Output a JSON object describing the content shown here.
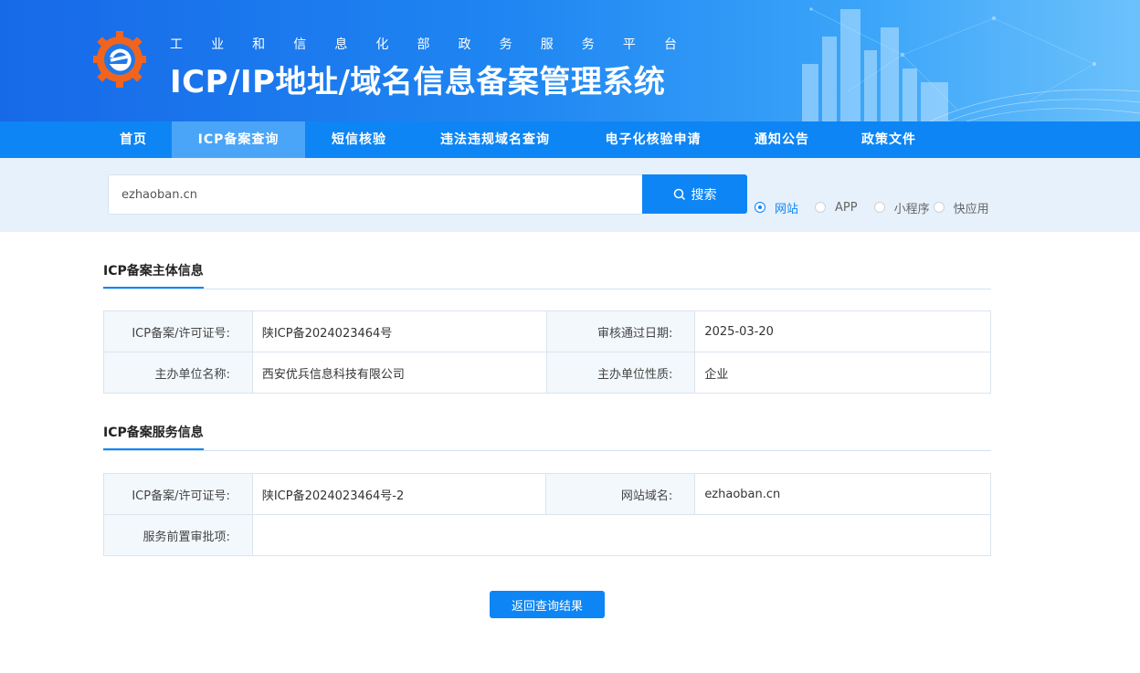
{
  "header": {
    "ministry_chars": [
      "工",
      "业",
      "和",
      "信",
      "息",
      "化",
      "部",
      "政",
      "务",
      "服",
      "务",
      "平",
      "台"
    ],
    "system_title": "ICP/IP地址/域名信息备案管理系统"
  },
  "nav": {
    "items": [
      {
        "label": "首页",
        "active": false
      },
      {
        "label": "ICP备案查询",
        "active": true
      },
      {
        "label": "短信核验",
        "active": false
      },
      {
        "label": "违法违规域名查询",
        "active": false
      },
      {
        "label": "电子化核验申请",
        "active": false
      },
      {
        "label": "通知公告",
        "active": false
      },
      {
        "label": "政策文件",
        "active": false
      }
    ]
  },
  "search": {
    "value": "ezhaoban.cn",
    "button_label": "搜索",
    "button_icon": "search-icon",
    "types": [
      {
        "label": "网站",
        "checked": true
      },
      {
        "label": "APP",
        "checked": false
      },
      {
        "label": "小程序",
        "checked": false
      },
      {
        "label": "快应用",
        "checked": false
      }
    ]
  },
  "subject_info": {
    "title": "ICP备案主体信息",
    "rows": [
      {
        "k1": "ICP备案/许可证号:",
        "v1": "陕ICP备2024023464号",
        "k2": "审核通过日期:",
        "v2": "2025-03-20"
      },
      {
        "k1": "主办单位名称:",
        "v1": "西安优兵信息科技有限公司",
        "k2": "主办单位性质:",
        "v2": "企业"
      }
    ]
  },
  "service_info": {
    "title": "ICP备案服务信息",
    "rows": [
      {
        "k1": "ICP备案/许可证号:",
        "v1": "陕ICP备2024023464号-2",
        "k2": "网站域名:",
        "v2": "ezhaoban.cn"
      }
    ],
    "preapproval_label": "服务前置审批项:",
    "preapproval_value": ""
  },
  "back_button_label": "返回查询结果",
  "colors": {
    "primary": "#0d85f5",
    "nav_active": "#4aa5f8",
    "search_bg": "#e6f1fc",
    "logo_orange": "#f0641e"
  }
}
